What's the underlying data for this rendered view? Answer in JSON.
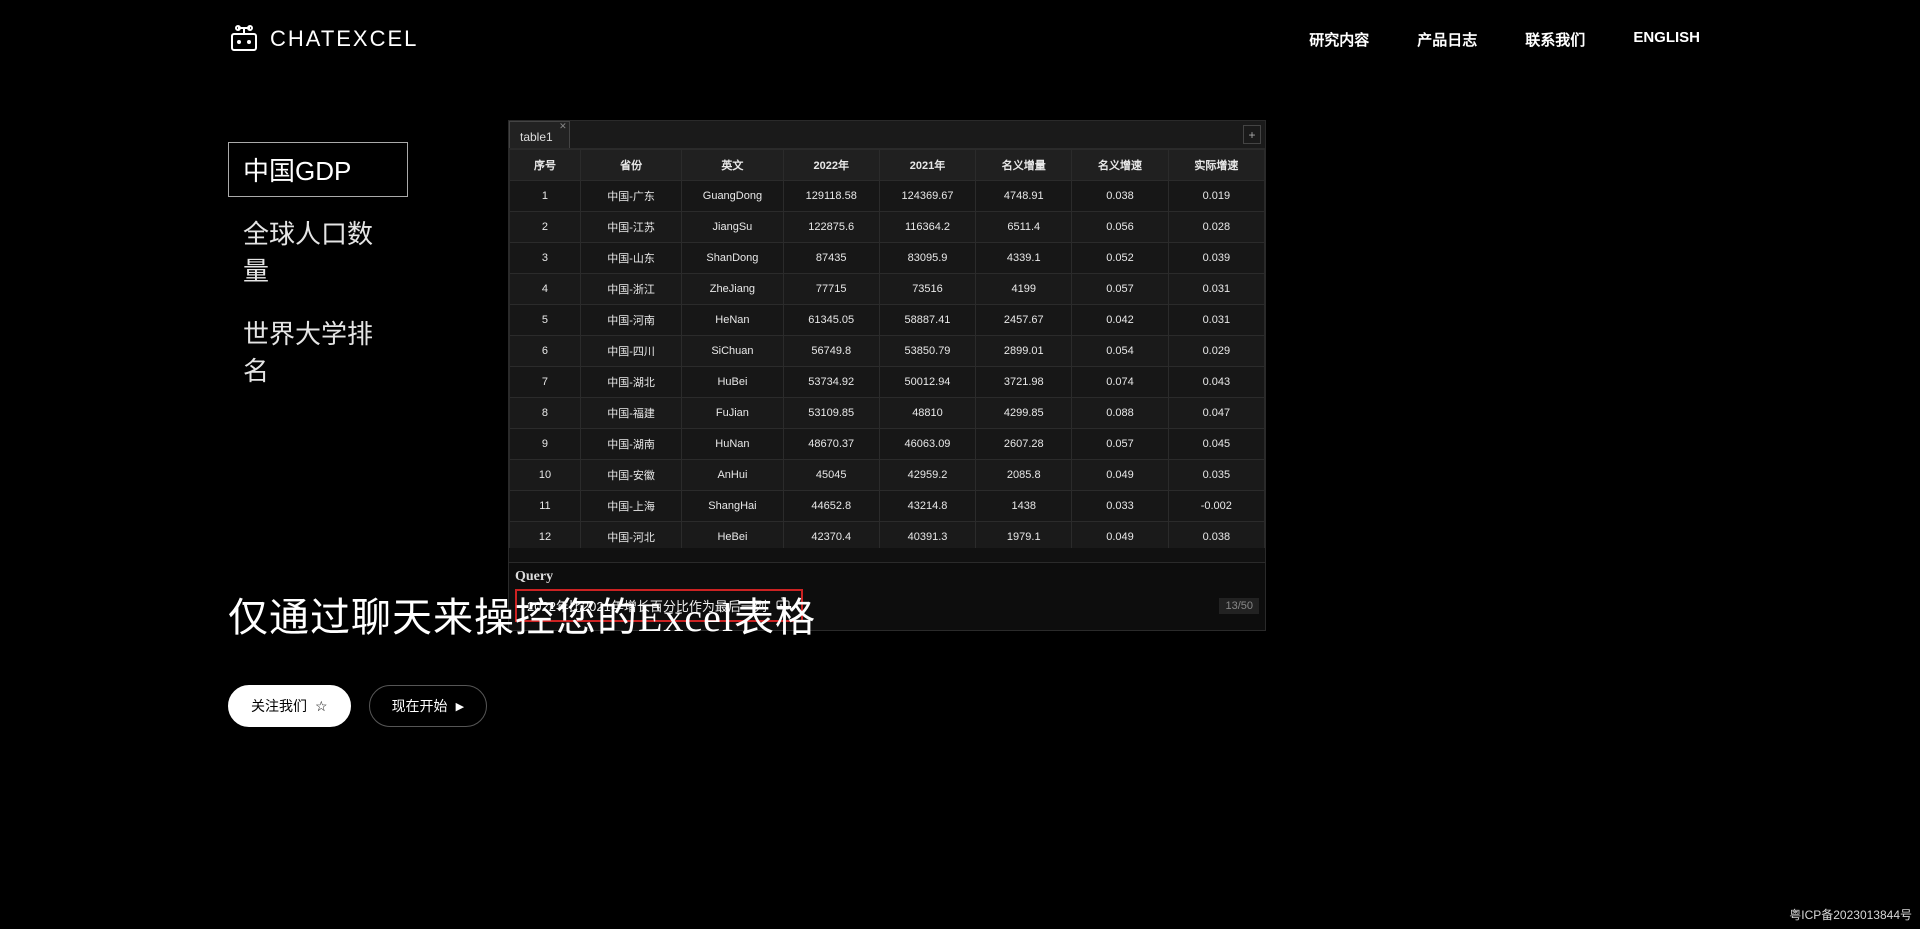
{
  "brand": "ChatExcel",
  "nav": {
    "research": "研究内容",
    "changelog": "产品日志",
    "contact": "联系我们",
    "lang": "ENGLISH"
  },
  "sideTabs": {
    "t0": "中国GDP",
    "t1": "全球人口数量",
    "t2": "世界大学排名"
  },
  "sheet": {
    "tabName": "table1",
    "addLabel": "+",
    "headers": {
      "c0": "序号",
      "c1": "省份",
      "c2": "英文",
      "c3": "2022年",
      "c4": "2021年",
      "c5": "名义增量",
      "c6": "名义增速",
      "c7": "实际增速"
    },
    "rows": [
      {
        "c0": "1",
        "c1": "中国-广东",
        "c2": "GuangDong",
        "c3": "129118.58",
        "c4": "124369.67",
        "c5": "4748.91",
        "c6": "0.038",
        "c7": "0.019"
      },
      {
        "c0": "2",
        "c1": "中国-江苏",
        "c2": "JiangSu",
        "c3": "122875.6",
        "c4": "116364.2",
        "c5": "6511.4",
        "c6": "0.056",
        "c7": "0.028"
      },
      {
        "c0": "3",
        "c1": "中国-山东",
        "c2": "ShanDong",
        "c3": "87435",
        "c4": "83095.9",
        "c5": "4339.1",
        "c6": "0.052",
        "c7": "0.039"
      },
      {
        "c0": "4",
        "c1": "中国-浙江",
        "c2": "ZheJiang",
        "c3": "77715",
        "c4": "73516",
        "c5": "4199",
        "c6": "0.057",
        "c7": "0.031"
      },
      {
        "c0": "5",
        "c1": "中国-河南",
        "c2": "HeNan",
        "c3": "61345.05",
        "c4": "58887.41",
        "c5": "2457.67",
        "c6": "0.042",
        "c7": "0.031"
      },
      {
        "c0": "6",
        "c1": "中国-四川",
        "c2": "SiChuan",
        "c3": "56749.8",
        "c4": "53850.79",
        "c5": "2899.01",
        "c6": "0.054",
        "c7": "0.029"
      },
      {
        "c0": "7",
        "c1": "中国-湖北",
        "c2": "HuBei",
        "c3": "53734.92",
        "c4": "50012.94",
        "c5": "3721.98",
        "c6": "0.074",
        "c7": "0.043"
      },
      {
        "c0": "8",
        "c1": "中国-福建",
        "c2": "FuJian",
        "c3": "53109.85",
        "c4": "48810",
        "c5": "4299.85",
        "c6": "0.088",
        "c7": "0.047"
      },
      {
        "c0": "9",
        "c1": "中国-湖南",
        "c2": "HuNan",
        "c3": "48670.37",
        "c4": "46063.09",
        "c5": "2607.28",
        "c6": "0.057",
        "c7": "0.045"
      },
      {
        "c0": "10",
        "c1": "中国-安徽",
        "c2": "AnHui",
        "c3": "45045",
        "c4": "42959.2",
        "c5": "2085.8",
        "c6": "0.049",
        "c7": "0.035"
      },
      {
        "c0": "11",
        "c1": "中国-上海",
        "c2": "ShangHai",
        "c3": "44652.8",
        "c4": "43214.8",
        "c5": "1438",
        "c6": "0.033",
        "c7": "-0.002"
      },
      {
        "c0": "12",
        "c1": "中国-河北",
        "c2": "HeBei",
        "c3": "42370.4",
        "c4": "40391.3",
        "c5": "1979.1",
        "c6": "0.049",
        "c7": "0.038"
      }
    ]
  },
  "query": {
    "label": "Query",
    "text": "2022年比2021年增长百分比作为最后一列",
    "counter": "13/50"
  },
  "hero": {
    "title": "仅通过聊天来操控您的Excel表格",
    "followBtn": "关注我们",
    "startBtn": "现在开始"
  },
  "footer": {
    "icp": "粤ICP备2023013844号"
  }
}
